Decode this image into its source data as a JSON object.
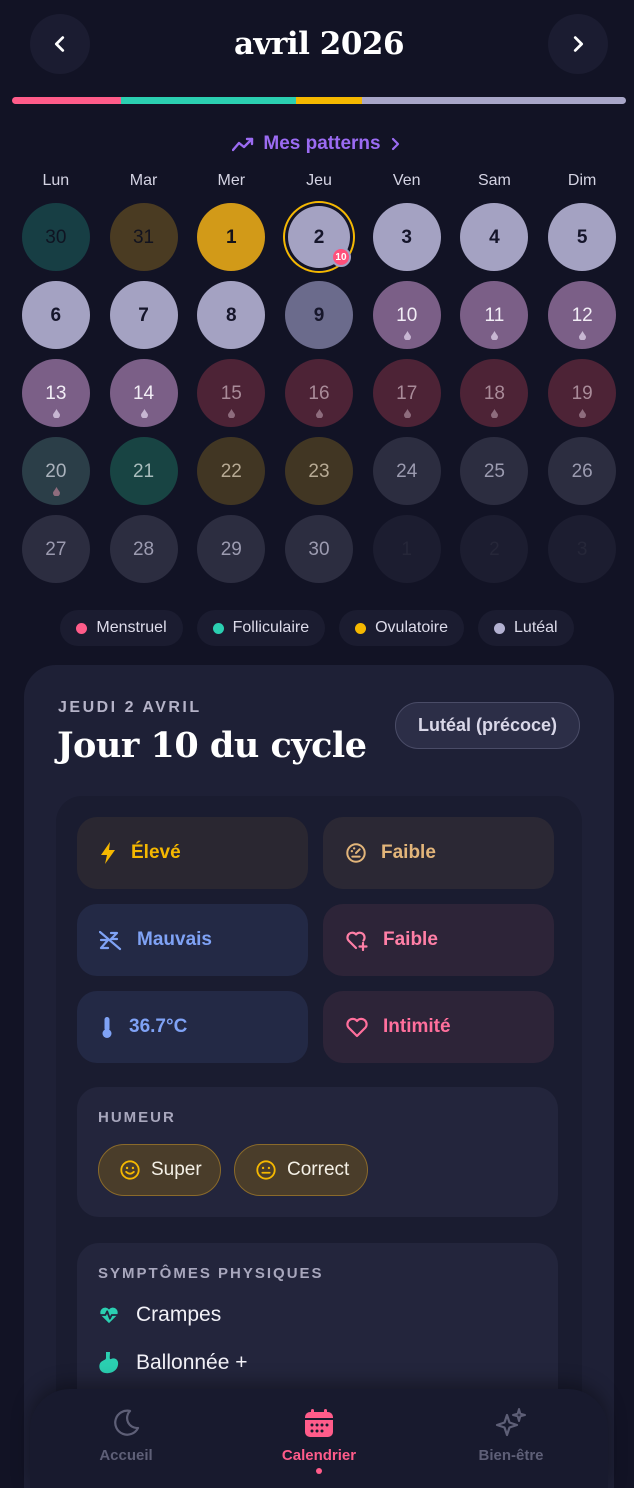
{
  "header": {
    "title": "avril 2026"
  },
  "cycle_bar": {
    "segments": [
      {
        "phase": "menstruel",
        "fraction": 0.178,
        "color": "#ff5c8a"
      },
      {
        "phase": "folliculaire",
        "fraction": 0.285,
        "color": "#2bcfb1"
      },
      {
        "phase": "ovulatoire",
        "fraction": 0.107,
        "color": "#f5b800"
      },
      {
        "phase": "luteal",
        "fraction": 0.43,
        "color": "#a8a6c8"
      }
    ]
  },
  "patterns": {
    "label": "Mes patterns"
  },
  "weekdays": [
    "Lun",
    "Mar",
    "Mer",
    "Jeu",
    "Ven",
    "Sam",
    "Dim"
  ],
  "phase_colors": {
    "foll-dark": {
      "bg": "#173e44",
      "fg": "#0f1422"
    },
    "ovul-dark": {
      "bg": "#4a3b22",
      "fg": "#12131f"
    },
    "ovul": {
      "bg": "#d29a18",
      "fg": "#15131a"
    },
    "luteal": {
      "bg": "#a4a2c2",
      "fg": "#15152a"
    },
    "luteal-dark": {
      "bg": "#6b6b8c",
      "fg": "#16162a"
    },
    "pms": {
      "bg": "#7b5f87",
      "fg": "#f2eef6"
    },
    "menstrual": {
      "bg": "#4d2336",
      "fg": "#a98b99"
    },
    "foll-late": {
      "bg": "#2b3e48",
      "fg": "#aab2bc"
    },
    "foll-teal": {
      "bg": "#184443",
      "fg": "#a9bdbd"
    },
    "ovul-muted": {
      "bg": "#413623",
      "fg": "#b7aa94"
    },
    "future": {
      "bg": "#2c2d40",
      "fg": "#9c9bb0"
    },
    "outside": {
      "bg": "#1c1d30",
      "fg": "#262739"
    }
  },
  "calendar": [
    {
      "n": "30",
      "phase": "foll-dark",
      "drop": false
    },
    {
      "n": "31",
      "phase": "ovul-dark",
      "drop": false
    },
    {
      "n": "1",
      "phase": "ovul",
      "drop": false
    },
    {
      "n": "2",
      "phase": "luteal",
      "drop": false,
      "selected": true,
      "badge": "10"
    },
    {
      "n": "3",
      "phase": "luteal",
      "drop": false
    },
    {
      "n": "4",
      "phase": "luteal",
      "drop": false
    },
    {
      "n": "5",
      "phase": "luteal",
      "drop": false
    },
    {
      "n": "6",
      "phase": "luteal",
      "drop": false
    },
    {
      "n": "7",
      "phase": "luteal",
      "drop": false
    },
    {
      "n": "8",
      "phase": "luteal",
      "drop": false
    },
    {
      "n": "9",
      "phase": "luteal-dark",
      "drop": false
    },
    {
      "n": "10",
      "phase": "pms",
      "drop": true
    },
    {
      "n": "11",
      "phase": "pms",
      "drop": true
    },
    {
      "n": "12",
      "phase": "pms",
      "drop": true
    },
    {
      "n": "13",
      "phase": "pms",
      "drop": true
    },
    {
      "n": "14",
      "phase": "pms",
      "drop": true
    },
    {
      "n": "15",
      "phase": "menstrual",
      "drop": true
    },
    {
      "n": "16",
      "phase": "menstrual",
      "drop": true
    },
    {
      "n": "17",
      "phase": "menstrual",
      "drop": true
    },
    {
      "n": "18",
      "phase": "menstrual",
      "drop": true
    },
    {
      "n": "19",
      "phase": "menstrual",
      "drop": true
    },
    {
      "n": "20",
      "phase": "foll-late",
      "drop": true
    },
    {
      "n": "21",
      "phase": "foll-teal",
      "drop": false
    },
    {
      "n": "22",
      "phase": "ovul-muted",
      "drop": false
    },
    {
      "n": "23",
      "phase": "ovul-muted",
      "drop": false
    },
    {
      "n": "24",
      "phase": "future",
      "drop": false
    },
    {
      "n": "25",
      "phase": "future",
      "drop": false
    },
    {
      "n": "26",
      "phase": "future",
      "drop": false
    },
    {
      "n": "27",
      "phase": "future",
      "drop": false
    },
    {
      "n": "28",
      "phase": "future",
      "drop": false
    },
    {
      "n": "29",
      "phase": "future",
      "drop": false
    },
    {
      "n": "30",
      "phase": "future",
      "drop": false
    },
    {
      "n": "1",
      "phase": "outside",
      "drop": false
    },
    {
      "n": "2",
      "phase": "outside",
      "drop": false
    },
    {
      "n": "3",
      "phase": "outside",
      "drop": false
    }
  ],
  "legend": [
    {
      "label": "Menstruel",
      "color": "#ff5c8a"
    },
    {
      "label": "Folliculaire",
      "color": "#2bcfb1"
    },
    {
      "label": "Ovulatoire",
      "color": "#f5b800"
    },
    {
      "label": "Lutéal",
      "color": "#b3b1d1"
    }
  ],
  "detail": {
    "date": "JEUDI 2 AVRIL",
    "title": "Jour 10 du cycle",
    "phase": "Lutéal (précoce)"
  },
  "metrics": {
    "energy": {
      "label": "Élevé",
      "icon": "lightning-icon",
      "color": "#f5b800"
    },
    "stress": {
      "label": "Faible",
      "icon": "gauge-icon",
      "color": "#e2b57a"
    },
    "sleep": {
      "label": "Mauvais",
      "icon": "sleep-off-icon",
      "color": "#7fa2f5"
    },
    "libido": {
      "label": "Faible",
      "icon": "heart-plus-icon",
      "color": "#ff7fa6"
    },
    "temperature": {
      "label": "36.7°C",
      "icon": "thermometer-icon",
      "color": "#7fa2f5"
    },
    "intimacy": {
      "label": "Intimité",
      "icon": "heart-icon",
      "color": "#ff6f9c"
    }
  },
  "mood": {
    "title": "HUMEUR",
    "chips": [
      {
        "label": "Super",
        "icon": "smile-icon"
      },
      {
        "label": "Correct",
        "icon": "neutral-face-icon"
      }
    ]
  },
  "symptoms": {
    "title": "SYMPTÔMES PHYSIQUES",
    "items": [
      {
        "label": "Crampes",
        "icon": "heartbeat-icon"
      },
      {
        "label": "Ballonnée +",
        "icon": "stomach-icon"
      }
    ]
  },
  "bottom_nav": {
    "tabs": [
      {
        "label": "Accueil",
        "icon": "moon-icon",
        "active": false
      },
      {
        "label": "Calendrier",
        "icon": "calendar-icon",
        "active": true
      },
      {
        "label": "Bien-être",
        "icon": "sparkles-icon",
        "active": false
      }
    ]
  }
}
